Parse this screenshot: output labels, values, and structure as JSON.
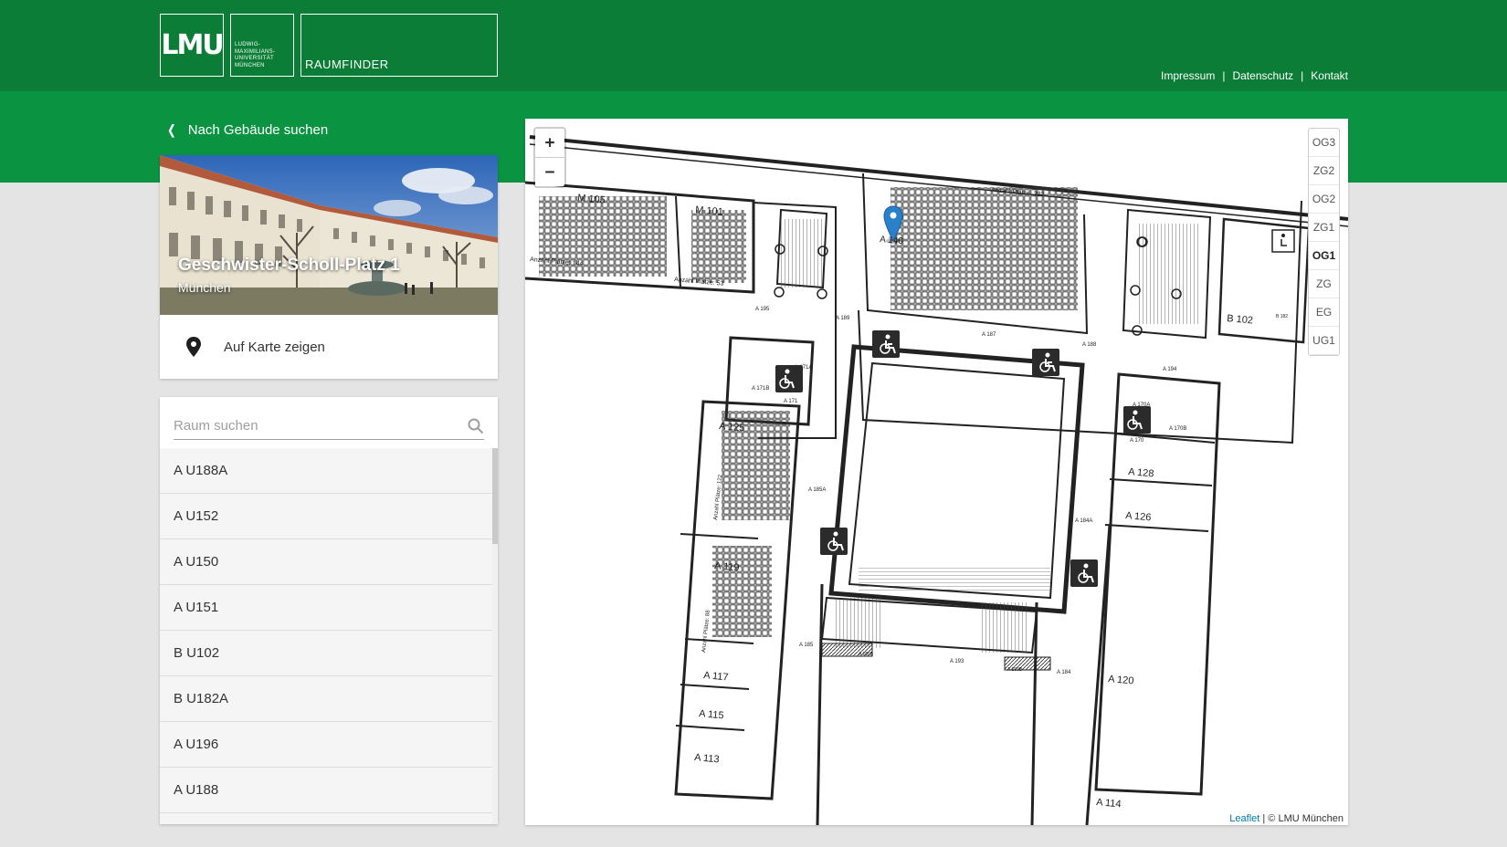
{
  "header": {
    "logo_text": "LMU",
    "university_lines": [
      "LUDWIG-",
      "MAXIMILIANS-",
      "UNIVERSITÄT",
      "MÜNCHEN"
    ],
    "app_title": "RAUMFINDER",
    "links": {
      "impressum": "Impressum",
      "datenschutz": "Datenschutz",
      "kontakt": "Kontakt"
    },
    "separator": "|"
  },
  "sidebar": {
    "back_label": "Nach Gebäude suchen",
    "building": {
      "address": "Geschwister-Scholl-Platz 1",
      "city": "München"
    },
    "show_on_map_label": "Auf Karte zeigen",
    "search": {
      "placeholder": "Raum suchen"
    },
    "rooms": [
      "A U188A",
      "A U152",
      "A U150",
      "A U151",
      "B U102",
      "B U182A",
      "A U196",
      "A U188"
    ],
    "list_scroll_position": 0.0
  },
  "map": {
    "zoom_in": "+",
    "zoom_out": "−",
    "floors": [
      "OG3",
      "ZG2",
      "OG2",
      "ZG1",
      "OG1",
      "ZG",
      "EG",
      "UG1"
    ],
    "active_floor": "OG1",
    "labels": [
      "M 105",
      "M 101",
      "Anzahl Plätze: 144",
      "Anzahl Plätze: 53",
      "A 140",
      "Anzahl Plätze: 382",
      "A 195",
      "A 189",
      "A 187",
      "A 188",
      "A 194",
      "B 102",
      "A 171A",
      "A 171B",
      "A 171",
      "WC",
      "A 170A",
      "A 170B",
      "A 170",
      "A 125",
      "Anzahl Plätze: 122",
      "A 185A",
      "A 184A",
      "A 128",
      "A 126",
      "A 119",
      "Anzahl Plätze: 88",
      "A 185",
      "A 193",
      "A 184",
      "A 185B",
      "A 193B",
      "A 117",
      "A 120",
      "A 115",
      "A 113",
      "A 114",
      "B 182"
    ],
    "attribution": {
      "leaflet": "Leaflet",
      "separator": "|",
      "copyright": "© LMU München"
    }
  }
}
